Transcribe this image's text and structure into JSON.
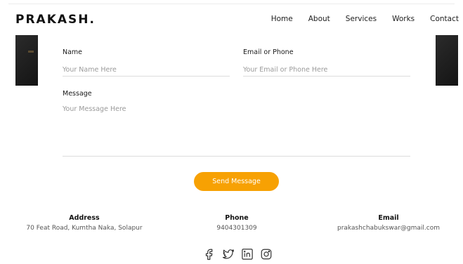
{
  "header": {
    "logo": "PRAKASH.",
    "nav": [
      "Home",
      "About",
      "Services",
      "Works",
      "Contact"
    ]
  },
  "form": {
    "name_label": "Name",
    "name_placeholder": "Your Name Here",
    "email_label": "Email or Phone",
    "email_placeholder": "Your Email or Phone Here",
    "message_label": "Message",
    "message_placeholder": "Your Message Here",
    "send_label": "Send Message"
  },
  "contact_info": {
    "address_title": "Address",
    "address_value": "70 Feat Road, Kumtha Naka, Solapur",
    "phone_title": "Phone",
    "phone_value": "9404301309",
    "email_title": "Email",
    "email_value": "prakashchabukswar@gmail.com"
  },
  "socials": [
    "facebook-icon",
    "twitter-icon",
    "linkedin-icon",
    "instagram-icon"
  ],
  "colors": {
    "accent": "#f7a103",
    "text": "#1c1c1c",
    "muted": "#9a9a9a"
  }
}
